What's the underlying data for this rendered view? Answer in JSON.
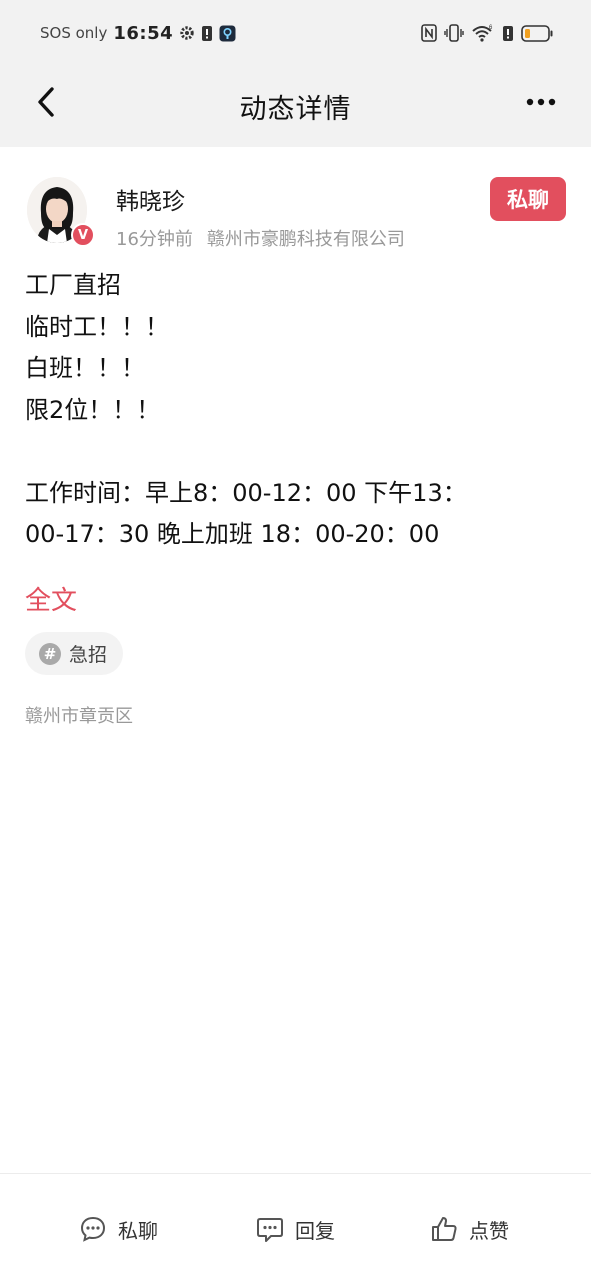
{
  "status_bar": {
    "network_text": "SOS only",
    "time": "16:54",
    "icons": [
      "gear-icon",
      "alert-icon",
      "app-icon",
      "nfc-icon",
      "vibrate-icon",
      "wifi-icon",
      "alert-icon",
      "battery-icon"
    ],
    "battery_color": "#f0a020"
  },
  "header": {
    "title": "动态详情",
    "back_icon": "chevron-left-icon",
    "more_icon": "more-dots-icon"
  },
  "post": {
    "author": {
      "name": "韩晓珍",
      "time_ago": "16分钟前",
      "company": "赣州市豪鹏科技有限公司",
      "verified_badge": "V"
    },
    "chat_button_label": "私聊",
    "content_lines": [
      "工厂直招",
      "临时工！！！",
      "白班！！！",
      "限2位！！！",
      "",
      "工作时间：早上8：00-12：00  下午13：",
      "00-17：30  晚上加班  18：00-20：00"
    ],
    "fulltext_label": "全文",
    "tag": {
      "icon": "#",
      "label": "急招"
    },
    "location": "赣州市章贡区"
  },
  "bottom_bar": {
    "chat_label": "私聊",
    "reply_label": "回复",
    "like_label": "点赞"
  },
  "colors": {
    "accent": "#e24f5e",
    "header_bg": "#f2f2f2",
    "meta_gray": "#999999"
  }
}
